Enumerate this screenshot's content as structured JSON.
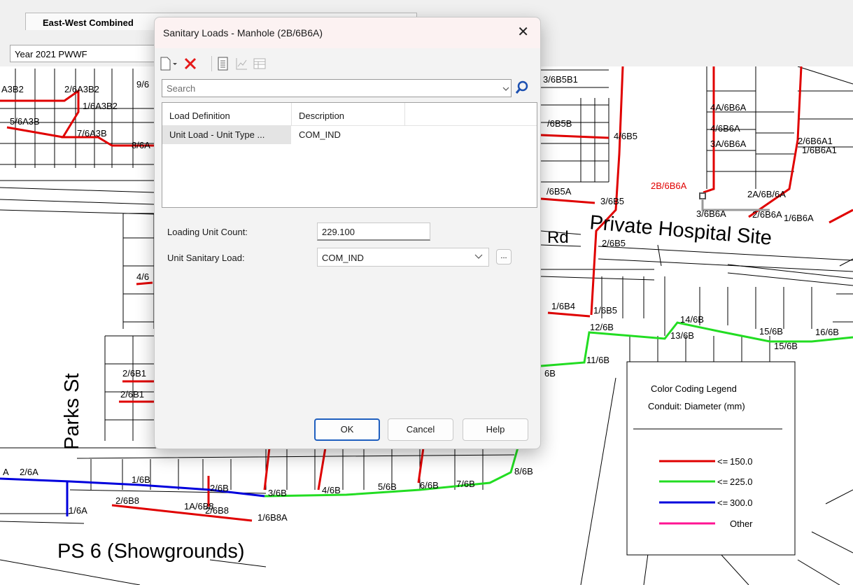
{
  "app": {
    "tab_title": "East-West Combined",
    "scenario": "Year 2021 PWWF"
  },
  "dialog": {
    "title": "Sanitary Loads - Manhole (2B/6B6A)",
    "search_placeholder": "Search",
    "columns": [
      "Load Definition",
      "Description"
    ],
    "rows": [
      {
        "load_definition": "Unit Load - Unit Type ...",
        "description": "COM_IND"
      }
    ],
    "loading_unit_count_label": "Loading Unit Count:",
    "loading_unit_count_value": "229.100",
    "unit_sanitary_load_label": "Unit Sanitary Load:",
    "unit_sanitary_load_value": "COM_IND",
    "ellipsis_label": "...",
    "ok_label": "OK",
    "cancel_label": "Cancel",
    "help_label": "Help",
    "close_glyph": "✕"
  },
  "map": {
    "street_labels": [
      "Parks St",
      "Private Hospital Site",
      "PS 6 (Showgrounds)",
      "Rd"
    ],
    "node_labels": [
      "A3B2",
      "2/6A3B2",
      "9/6",
      "1/6A3B2",
      "5/6A3B",
      "7/6A3B",
      "8/6A",
      "3/6B5B1",
      "/6B5B",
      "4/6B5",
      "/6B5A",
      "3/6B5",
      "2/6B5",
      "4A/6B6A",
      "4/6B6A",
      "3A/6B6A",
      "2/6B6A1",
      "1/6B6A1",
      "2B/6B6A",
      "2A/6B/6A",
      "3/6B6A",
      "2/6B6A",
      "1/6B6A",
      "4/6",
      "2/6B1",
      "2/6B1",
      "1/6B4",
      "1/6B5",
      "12/6B",
      "14/6B",
      "13/6B",
      "15/6B",
      "16/6B",
      "15/6B",
      "11/6B",
      "6B",
      "2/6A",
      "1/6B",
      "2/6B",
      "2/6B8",
      "1A/6B8",
      "2/6B8",
      "1/6B8A",
      "3/6B",
      "4/6B",
      "5/6B",
      "6/6B",
      "7/6B",
      "8/6B",
      "1/6A",
      "A"
    ],
    "legend": {
      "title": "Color Coding Legend",
      "subtitle": "Conduit: Diameter (mm)",
      "items": [
        {
          "op": "<=",
          "value": "150.0",
          "color": "#e00000"
        },
        {
          "op": "<=",
          "value": "225.0",
          "color": "#22dd22"
        },
        {
          "op": "<=",
          "value": "300.0",
          "color": "#0000dd"
        },
        {
          "op": "",
          "value": "Other",
          "color": "#ff1493"
        }
      ]
    }
  }
}
